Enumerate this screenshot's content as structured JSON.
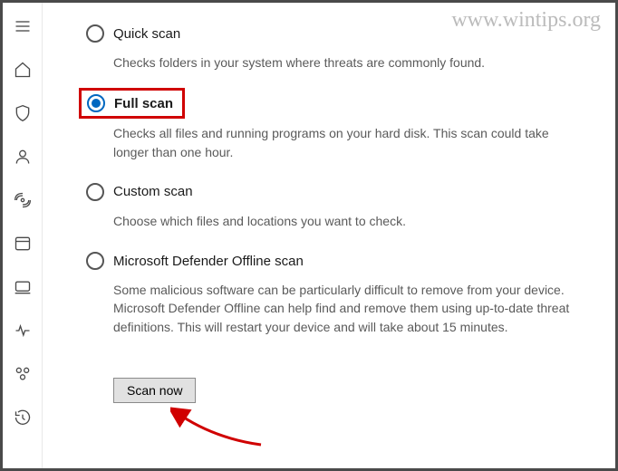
{
  "watermark": "www.wintips.org",
  "sidebar": {
    "icons": [
      "menu-icon",
      "home-icon",
      "shield-icon",
      "account-icon",
      "firewall-icon",
      "app-browser-icon",
      "device-icon",
      "performance-icon",
      "family-icon",
      "history-icon"
    ]
  },
  "scan_options": [
    {
      "id": "quick",
      "label": "Quick scan",
      "selected": false,
      "highlighted": false,
      "description": "Checks folders in your system where threats are commonly found."
    },
    {
      "id": "full",
      "label": "Full scan",
      "selected": true,
      "highlighted": true,
      "description": "Checks all files and running programs on your hard disk. This scan could take longer than one hour."
    },
    {
      "id": "custom",
      "label": "Custom scan",
      "selected": false,
      "highlighted": false,
      "description": "Choose which files and locations you want to check."
    },
    {
      "id": "offline",
      "label": "Microsoft Defender Offline scan",
      "selected": false,
      "highlighted": false,
      "description": "Some malicious software can be particularly difficult to remove from your device. Microsoft Defender Offline can help find and remove them using up-to-date threat definitions. This will restart your device and will take about 15 minutes."
    }
  ],
  "button": {
    "scan_now": "Scan now"
  }
}
